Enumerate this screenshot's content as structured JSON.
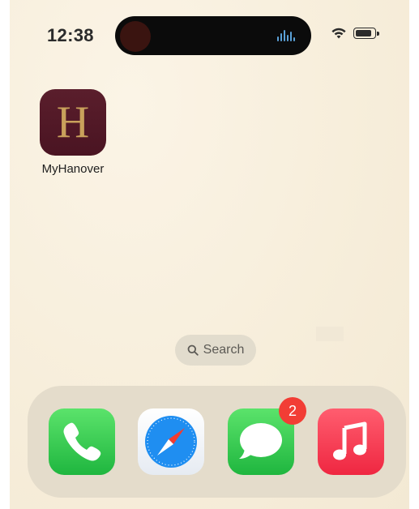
{
  "status_bar": {
    "time": "12:38",
    "icons": [
      "wifi-icon",
      "battery-icon"
    ]
  },
  "home_screen": {
    "apps": [
      {
        "label": "MyHanover",
        "glyph": "H",
        "icon": "myhanover-icon"
      }
    ],
    "search_pill": {
      "label": "Search",
      "icon": "search-icon"
    }
  },
  "dock": {
    "apps": [
      {
        "name": "Phone",
        "icon": "phone-icon"
      },
      {
        "name": "Safari",
        "icon": "safari-icon"
      },
      {
        "name": "Messages",
        "icon": "messages-icon",
        "badge": "2"
      },
      {
        "name": "Music",
        "icon": "music-icon"
      }
    ]
  },
  "colors": {
    "wallpaper": "#f7eedb",
    "hanover_maroon": "#4a1422",
    "hanover_gold": "#c9a15b",
    "badge_red": "#f23d35"
  }
}
